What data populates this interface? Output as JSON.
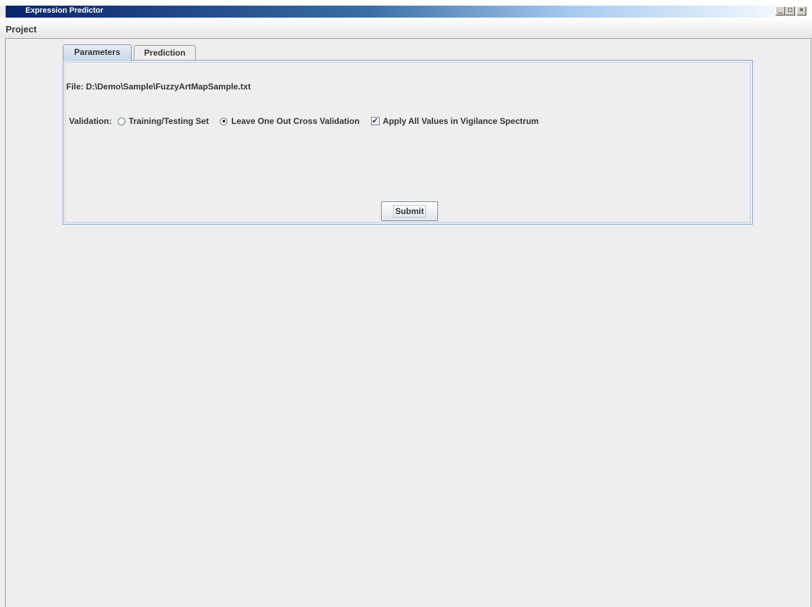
{
  "window": {
    "title": "Expression Predictor",
    "buttons": {
      "minimize": "_",
      "maximize": "□",
      "close": "×"
    }
  },
  "menubar": {
    "items": [
      "Project"
    ]
  },
  "tabs": [
    {
      "label": "Parameters",
      "active": true
    },
    {
      "label": "Prediction",
      "active": false
    }
  ],
  "parameters": {
    "file_label": "File:",
    "file_path": "D:\\Demo\\Sample\\FuzzyArtMapSample.txt",
    "validation_label": "Validation:",
    "options": [
      {
        "label": "Training/Testing Set",
        "selected": false
      },
      {
        "label": "Leave One Out Cross Validation",
        "selected": true
      }
    ],
    "checkbox": {
      "label": "Apply All Values in Vigilance Spectrum",
      "checked": true
    },
    "submit_label": "Submit"
  },
  "colors": {
    "title_gradient_start": "#0a246a",
    "title_gradient_mid": "#3a6ea5",
    "panel_border": "#8ca6cc",
    "background": "#eeeeee"
  }
}
